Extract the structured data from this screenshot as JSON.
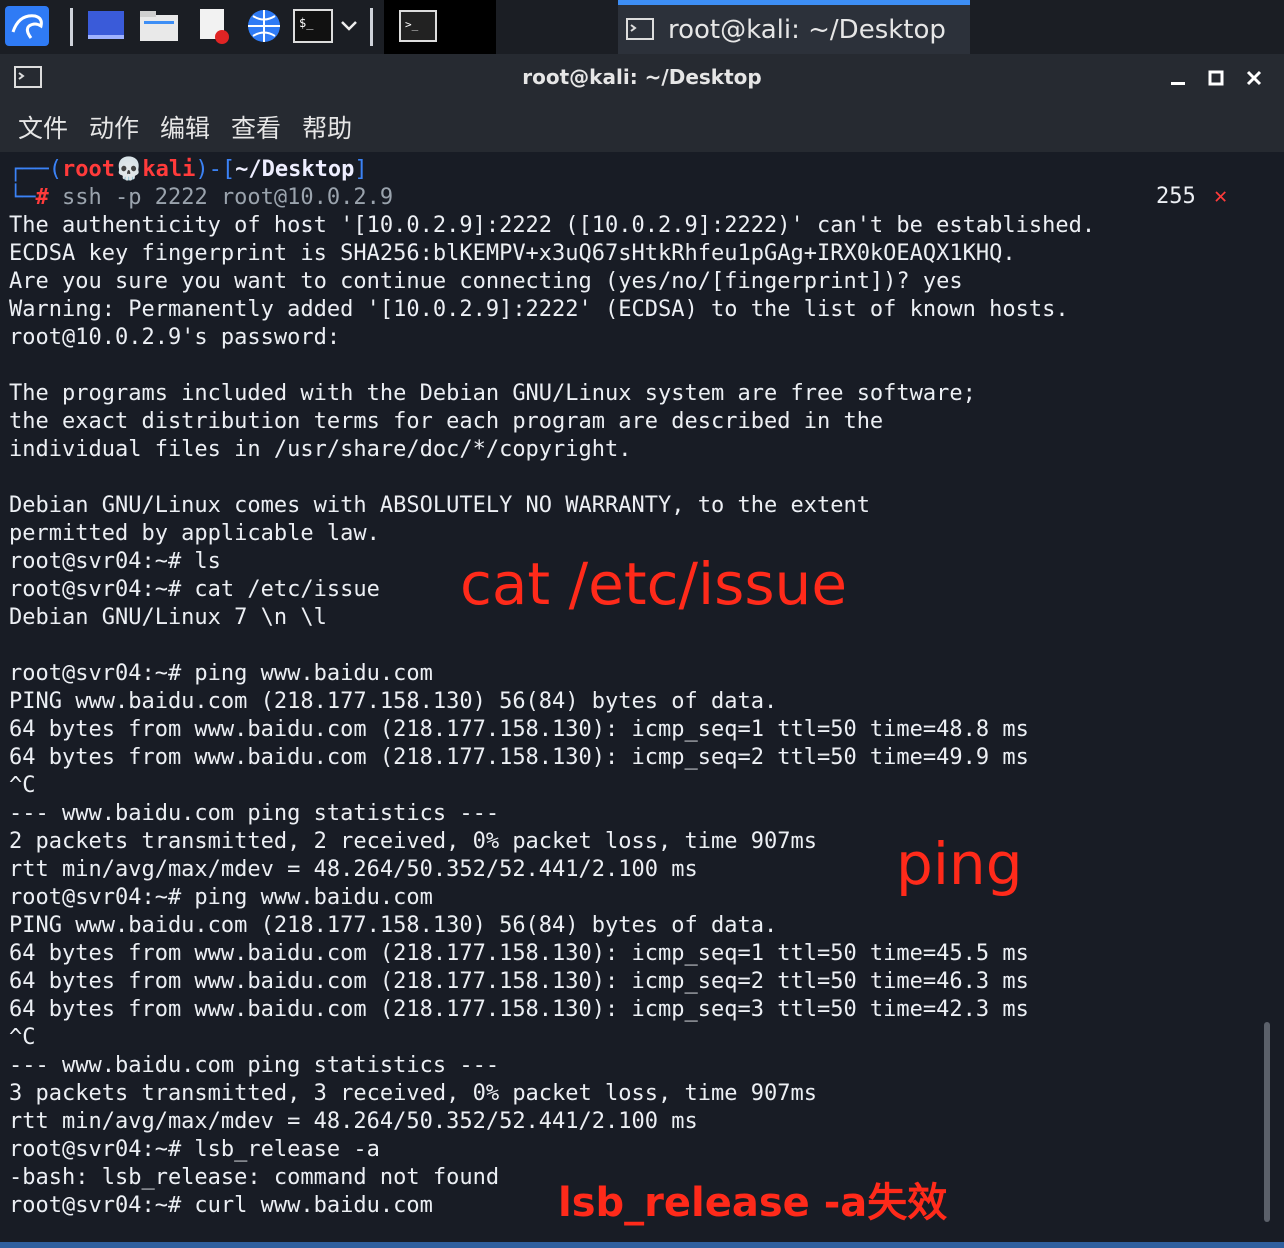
{
  "taskbar": {
    "icons": [
      "kali-dragon-icon",
      "workspace-icon",
      "file-manager-icon",
      "text-editor-icon",
      "web-browser-icon",
      "terminal-icon",
      "chevron-down-icon"
    ],
    "task_title": "root@kali: ~/Desktop"
  },
  "window": {
    "title": "root@kali: ~/Desktop",
    "menu": [
      "文件",
      "动作",
      "编辑",
      "查看",
      "帮助"
    ]
  },
  "prompt": {
    "user": "root",
    "host": "kali",
    "dir": "~/Desktop",
    "command": "ssh -p 2222 root@10.0.2.9",
    "exit_code": "255",
    "exit_mark": "✕"
  },
  "terminal_lines": [
    "The authenticity of host '[10.0.2.9]:2222 ([10.0.2.9]:2222)' can't be established.",
    "ECDSA key fingerprint is SHA256:blKEMPV+x3uQ67sHtkRhfeu1pGAg+IRX0kOEAQX1KHQ.",
    "Are you sure you want to continue connecting (yes/no/[fingerprint])? yes",
    "Warning: Permanently added '[10.0.2.9]:2222' (ECDSA) to the list of known hosts.",
    "root@10.0.2.9's password:",
    "",
    "The programs included with the Debian GNU/Linux system are free software;",
    "the exact distribution terms for each program are described in the",
    "individual files in /usr/share/doc/*/copyright.",
    "",
    "Debian GNU/Linux comes with ABSOLUTELY NO WARRANTY, to the extent",
    "permitted by applicable law.",
    "root@svr04:~# ls",
    "root@svr04:~# cat /etc/issue",
    "Debian GNU/Linux 7 \\n \\l",
    "",
    "root@svr04:~# ping www.baidu.com",
    "PING www.baidu.com (218.177.158.130) 56(84) bytes of data.",
    "64 bytes from www.baidu.com (218.177.158.130): icmp_seq=1 ttl=50 time=48.8 ms",
    "64 bytes from www.baidu.com (218.177.158.130): icmp_seq=2 ttl=50 time=49.9 ms",
    "^C",
    "--- www.baidu.com ping statistics ---",
    "2 packets transmitted, 2 received, 0% packet loss, time 907ms",
    "rtt min/avg/max/mdev = 48.264/50.352/52.441/2.100 ms",
    "root@svr04:~# ping www.baidu.com",
    "PING www.baidu.com (218.177.158.130) 56(84) bytes of data.",
    "64 bytes from www.baidu.com (218.177.158.130): icmp_seq=1 ttl=50 time=45.5 ms",
    "64 bytes from www.baidu.com (218.177.158.130): icmp_seq=2 ttl=50 time=46.3 ms",
    "64 bytes from www.baidu.com (218.177.158.130): icmp_seq=3 ttl=50 time=42.3 ms",
    "^C",
    "--- www.baidu.com ping statistics ---",
    "3 packets transmitted, 3 received, 0% packet loss, time 907ms",
    "rtt min/avg/max/mdev = 48.264/50.352/52.441/2.100 ms",
    "root@svr04:~# lsb_release -a",
    "-bash: lsb_release: command not found",
    "root@svr04:~# curl www.baidu.com"
  ],
  "annotations": {
    "cat": "cat /etc/issue",
    "ping": "ping",
    "lsb": "lsb_release -a失效"
  },
  "colors": {
    "annotation": "#ff2a1a",
    "prompt_red": "#ff3b3b",
    "prompt_blue": "#3b82f6",
    "accent": "#3d8ef5"
  }
}
